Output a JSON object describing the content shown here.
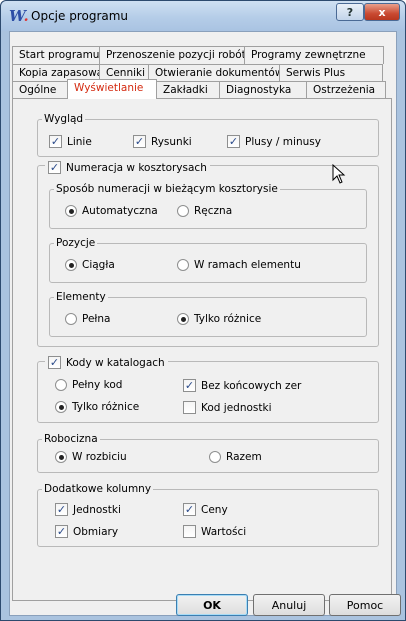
{
  "window": {
    "title": "Opcje programu",
    "help_label": "?",
    "close_label": "x"
  },
  "tabs": {
    "row1": [
      "Start programu",
      "Przenoszenie pozycji robót",
      "Programy zewnętrzne"
    ],
    "row2": [
      "Kopia zapasowa",
      "Cenniki",
      "Otwieranie dokumentów",
      "Serwis Plus"
    ],
    "row3": [
      "Ogólne",
      "Wyświetlanie",
      "Zakładki",
      "Diagnostyka",
      "Ostrzeżenia"
    ],
    "active": "Wyświetlanie"
  },
  "wyglad": {
    "legend": "Wygląd",
    "linie": {
      "label": "Linie",
      "checked": true
    },
    "rysunki": {
      "label": "Rysunki",
      "checked": true
    },
    "plusy": {
      "label": "Plusy / minusy",
      "checked": true
    }
  },
  "numeracja": {
    "legend": "Numeracja w kosztorysach",
    "checked": true,
    "sposob": {
      "legend": "Sposób numeracji w bieżącym kosztorysie",
      "automatyczna": "Automatyczna",
      "reczna": "Ręczna",
      "selected": "Automatyczna"
    },
    "pozycje": {
      "legend": "Pozycje",
      "ciagla": "Ciągła",
      "w_ramach": "W ramach elementu",
      "selected": "Ciągła"
    },
    "elementy": {
      "legend": "Elementy",
      "pelna": "Pełna",
      "tylko": "Tylko różnice",
      "selected": "Tylko różnice"
    }
  },
  "kody": {
    "legend": "Kody w katalogach",
    "checked": true,
    "pelny": "Pełny kod",
    "tylko": "Tylko różnice",
    "selected": "Tylko różnice",
    "bez_zer": {
      "label": "Bez końcowych zer",
      "checked": true
    },
    "kod_jednostki": {
      "label": "Kod jednostki",
      "checked": false
    }
  },
  "robocizna": {
    "legend": "Robocizna",
    "w_rozbiciu": "W rozbiciu",
    "razem": "Razem",
    "selected": "W rozbiciu"
  },
  "dodatkowe": {
    "legend": "Dodatkowe kolumny",
    "jednostki": {
      "label": "Jednostki",
      "checked": true
    },
    "ceny": {
      "label": "Ceny",
      "checked": true
    },
    "obmiary": {
      "label": "Obmiary",
      "checked": true
    },
    "wartosci": {
      "label": "Wartości",
      "checked": false
    }
  },
  "buttons": {
    "ok": "OK",
    "anuluj": "Anuluj",
    "pomoc": "Pomoc"
  }
}
